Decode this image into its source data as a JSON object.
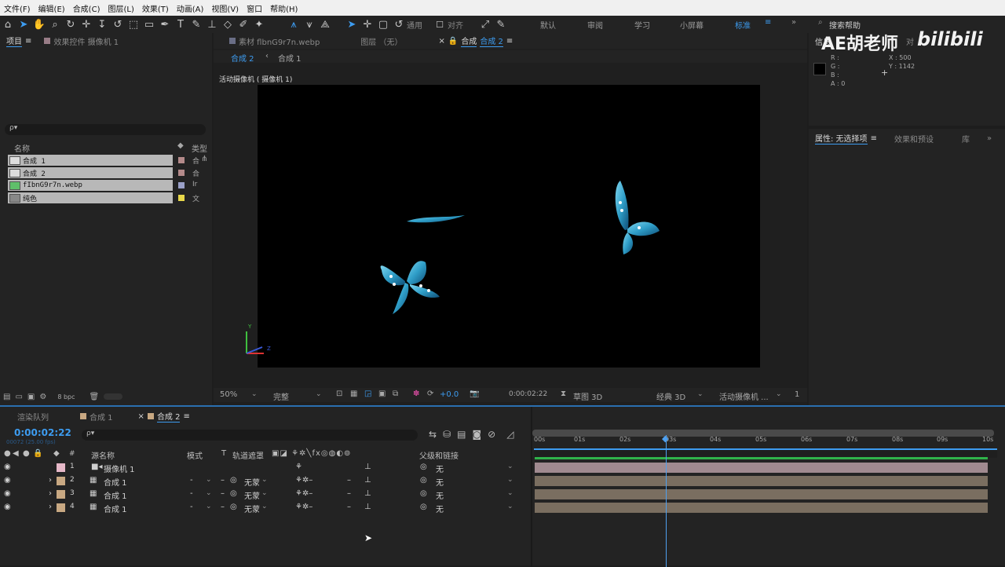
{
  "menu": [
    "文件(F)",
    "编辑(E)",
    "合成(C)",
    "图层(L)",
    "效果(T)",
    "动画(A)",
    "视图(V)",
    "窗口",
    "帮助(H)"
  ],
  "toolbar": {
    "snap_label": "通用",
    "align_label": "对齐",
    "workspaces": [
      "默认",
      "审阅",
      "学习",
      "小屏幕",
      "标准"
    ],
    "search_placeholder": "搜索帮助"
  },
  "project_panel": {
    "tab_label": "项目",
    "effect_tab_label": "效果控件 摄像机 1",
    "search_placeholder": "ρ▾",
    "col_name": "名称",
    "col_type": "类型",
    "items": [
      {
        "name": "合成 1",
        "type": "合",
        "color": "#b48a8a"
      },
      {
        "name": "合成 2",
        "type": "合",
        "color": "#b48a8a"
      },
      {
        "name": "fIbnG9r7n.webp",
        "type": "Ir",
        "color": "#9aa0c8"
      },
      {
        "name": "纯色",
        "type": "文",
        "color": "#e8d84a"
      }
    ],
    "bpc": "8 bpc"
  },
  "viewer": {
    "tab_footage": "素材 flbnG9r7n.webp",
    "tab_layer": "图层 （无）",
    "tab_comp": "合成",
    "tab_comp_name": "合成 2",
    "breadcrumb": [
      "合成 2",
      "合成 1"
    ],
    "camera_label": "活动摄像机 ( 摄像机 1)",
    "zoom": "50%",
    "quality": "完整",
    "exposure": "+0.0",
    "timecode": "0:00:02:22",
    "draft3d": "草图 3D",
    "renderer": "经典 3D",
    "view": "活动摄像机 ...",
    "view_count": "1",
    "axis_y": "Y",
    "axis_z": "Z"
  },
  "info_panel": {
    "tab_label": "信息",
    "align_tab": "对",
    "r": "R :",
    "g": "G :",
    "b": "B :",
    "a": "A : 0",
    "x": "X : 500",
    "y": "Y : 1142"
  },
  "watermark": {
    "text": "AE胡老师",
    "brand": "bilibili"
  },
  "properties_panel": {
    "tab_label": "属性: 无选择项",
    "effects_tab": "效果和预设",
    "library_tab": "库"
  },
  "timeline": {
    "tab_render": "渲染队列",
    "tab_comp1": "合成 1",
    "tab_comp2": "合成 2",
    "current_time": "0:00:02:22",
    "frame_info": "00072 (25.00 fps)",
    "search_placeholder": "ρ▾",
    "col_source": "源名称",
    "col_mode": "模式",
    "col_t": "T",
    "col_trackmatte": "轨道遮罩",
    "col_parent": "父级和链接",
    "hash": "#",
    "layers": [
      {
        "num": "1",
        "name": "摄像机 1",
        "color": "#e6b8c8",
        "mode": "",
        "matte": "",
        "parent": "无",
        "bar_color": "#a08a90"
      },
      {
        "num": "2",
        "name": "合成 1",
        "color": "#c8a882",
        "mode": "-",
        "matte": "无蒙",
        "parent": "无",
        "bar_color": "#7a6e60"
      },
      {
        "num": "3",
        "name": "合成 1",
        "color": "#c8a882",
        "mode": "-",
        "matte": "无蒙",
        "parent": "无",
        "bar_color": "#7a6e60"
      },
      {
        "num": "4",
        "name": "合成 1",
        "color": "#c8a882",
        "mode": "-",
        "matte": "无蒙",
        "parent": "无",
        "bar_color": "#7a6e60"
      }
    ],
    "ruler": [
      "00s",
      "01s",
      "02s",
      "03s",
      "04s",
      "05s",
      "06s",
      "07s",
      "08s",
      "09s",
      "10s"
    ],
    "playhead_seconds": 2.88
  },
  "colors": {
    "accent": "#3d9cf0",
    "green": "#2fb34a"
  }
}
